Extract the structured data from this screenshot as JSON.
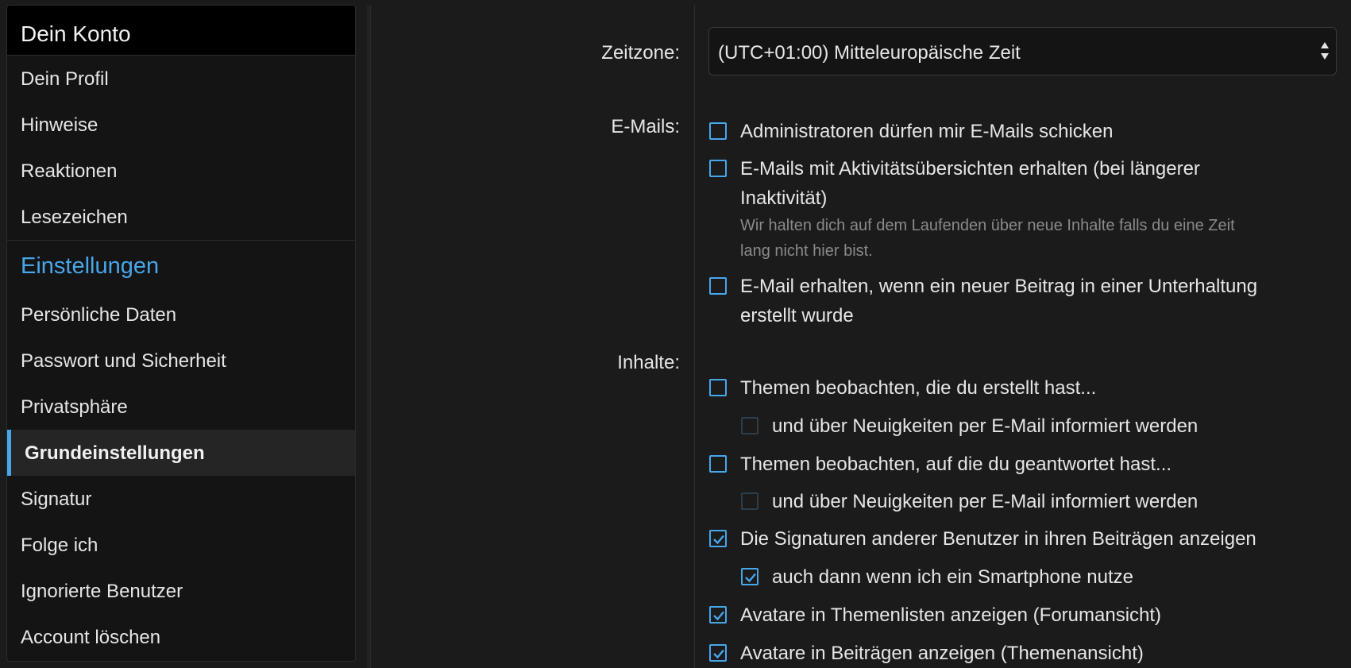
{
  "sidebar": {
    "header": "Dein Konto",
    "account_items": [
      {
        "label": "Dein Profil"
      },
      {
        "label": "Hinweise"
      },
      {
        "label": "Reaktionen"
      },
      {
        "label": "Lesezeichen"
      }
    ],
    "settings_heading": "Einstellungen",
    "settings_items": [
      {
        "label": "Persönliche Daten"
      },
      {
        "label": "Passwort und Sicherheit"
      },
      {
        "label": "Privatsphäre"
      },
      {
        "label": "Grundeinstellungen",
        "active": true
      },
      {
        "label": "Signatur"
      },
      {
        "label": "Folge ich"
      },
      {
        "label": "Ignorierte Benutzer"
      },
      {
        "label": "Account löschen"
      }
    ]
  },
  "form": {
    "timezone_label": "Zeitzone:",
    "timezone_value": "(UTC+01:00) Mitteleuropäische Zeit",
    "emails_label": "E-Mails:",
    "emails": [
      {
        "text": "Administratoren dürfen mir E-Mails schicken",
        "checked": false
      },
      {
        "text_line1": "E-Mails mit Aktivitätsübersichten erhalten (bei längerer",
        "text_line2": "Inaktivität)",
        "checked": false,
        "hint_line1": "Wir halten dich auf dem Laufenden über neue Inhalte falls du eine Zeit",
        "hint_line2": "lang nicht hier bist."
      },
      {
        "text_line1": "E-Mail erhalten, wenn ein neuer Beitrag in einer Unterhaltung",
        "text_line2": "erstellt wurde",
        "checked": false
      }
    ],
    "content_label": "Inhalte:",
    "content": [
      {
        "text": "Themen beobachten, die du erstellt hast...",
        "checked": false
      },
      {
        "text": "und über Neuigkeiten per E-Mail informiert werden",
        "checked": false,
        "sub": true
      },
      {
        "text": "Themen beobachten, auf die du geantwortet hast...",
        "checked": false
      },
      {
        "text": "und über Neuigkeiten per E-Mail informiert werden",
        "checked": false,
        "sub": true
      },
      {
        "text": "Die Signaturen anderer Benutzer in ihren Beiträgen anzeigen",
        "checked": true
      },
      {
        "text": "auch dann wenn ich ein Smartphone nutze",
        "checked": true,
        "sub": true
      },
      {
        "text": "Avatare in Themenlisten anzeigen (Forumansicht)",
        "checked": true
      },
      {
        "text": "Avatare in Beiträgen anzeigen (Themenansicht)",
        "checked": true
      }
    ]
  },
  "colors": {
    "accent": "#47a7eb",
    "background": "#1b1b1b",
    "sidebar": "#141414"
  }
}
